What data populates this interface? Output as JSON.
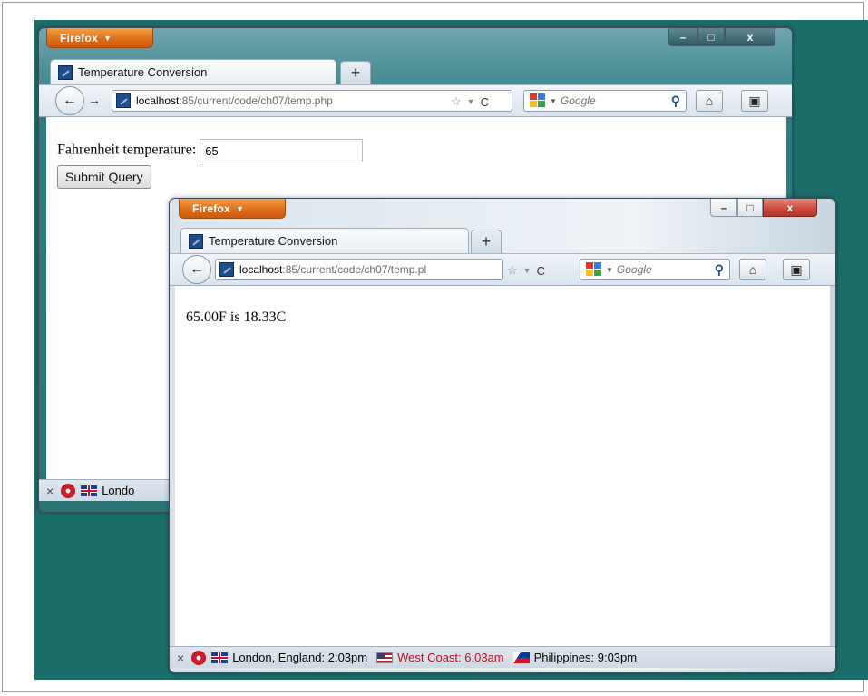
{
  "back_window": {
    "app_button": "Firefox",
    "tab_title": "Temperature Conversion",
    "url_host": "localhost",
    "url_path": ":85/current/code/ch07/temp.php",
    "search_placeholder": "Google",
    "form": {
      "label": "Fahrenheit temperature:",
      "value": "65",
      "submit_label": "Submit Query"
    },
    "status_text": "Londo"
  },
  "front_window": {
    "app_button": "Firefox",
    "tab_title": "Temperature Conversion",
    "url_host": "localhost",
    "url_path": ":85/current/code/ch07/temp.pl",
    "search_placeholder": "Google",
    "result": "65.00F is 18.33C",
    "status": {
      "clock1": "London, England: 2:03pm",
      "clock2": "West Coast: 6:03am",
      "clock3": "Philippines: 9:03pm"
    }
  },
  "glyphs": {
    "dropdown": "▼",
    "plus": "+",
    "back": "←",
    "forward": "→",
    "star": "☆",
    "reload": "C",
    "search": "⚲",
    "home": "⌂",
    "bookmarks": "▣",
    "close_x": "×",
    "minimize": "–",
    "maximize": "□",
    "win_close": "x"
  },
  "colors": {
    "desktop": "#1d6c6c",
    "firefox_button": "#e0701c",
    "close_button": "#c9473d"
  }
}
